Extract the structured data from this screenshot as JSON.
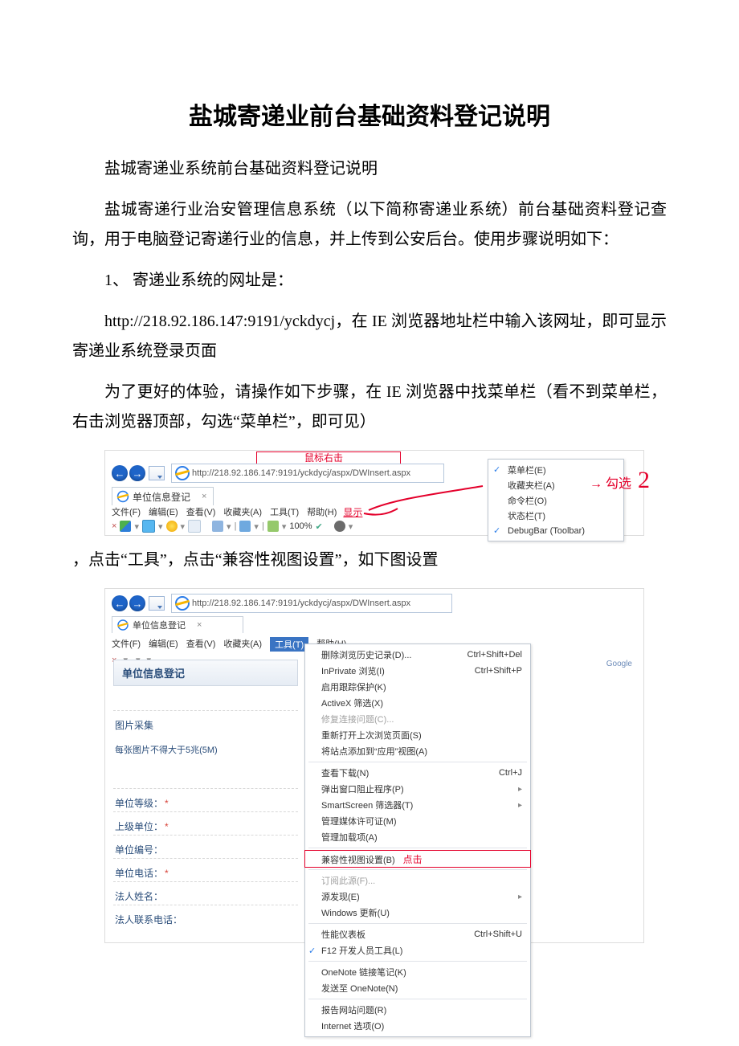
{
  "title": "盐城寄递业前台基础资料登记说明",
  "p1": "盐城寄递业系统前台基础资料登记说明",
  "p2": "盐城寄递行业治安管理信息系统（以下简称寄递业系统）前台基础资料登记查询，用于电脑登记寄递行业的信息，并上传到公安后台。使用步骤说明如下：",
  "p3": "1、 寄递业系统的网址是：",
  "p4": "http://218.92.186.147:9191/yckdycj，在 IE 浏览器地址栏中输入该网址，即可显示寄递业系统登录页面",
  "p5": "为了更好的体验，请操作如下步骤，在 IE 浏览器中找菜单栏（看不到菜单栏，右击浏览器顶部，勾选“菜单栏”，即可见）",
  "p6": "，点击“工具”，点击“兼容性视图设置”，如下图设置",
  "ss1": {
    "annot_rightclick": "鼠标右击",
    "annot_check": "勾选",
    "annot_show": "显示",
    "url": "http://218.92.186.147:9191/yckdycj/aspx/DWInsert.aspx",
    "tab_title": "单位信息登记",
    "menus": [
      "文件(F)",
      "编辑(E)",
      "查看(V)",
      "收藏夹(A)",
      "工具(T)",
      "帮助(H)"
    ],
    "zoom": "100%",
    "context_menu": [
      {
        "label": "菜单栏(E)",
        "checked": true
      },
      {
        "label": "收藏夹栏(A)",
        "checked": false
      },
      {
        "label": "命令栏(O)",
        "checked": false
      },
      {
        "label": "状态栏(T)",
        "checked": false
      },
      {
        "label": "DebugBar (Toolbar)",
        "checked": true
      }
    ]
  },
  "ss2": {
    "url": "http://218.92.186.147:9191/yckdycj/aspx/DWInsert.aspx",
    "tab_title": "单位信息登记",
    "menus_left": [
      "文件(F)",
      "编辑(E)",
      "查看(V)",
      "收藏夹(A)"
    ],
    "menu_tools": "工具(T)",
    "menu_help": "帮助(H)",
    "form_title": "单位信息登记",
    "form_sec1": "图片采集",
    "form_sec1_note": "每张图片不得大于5兆(5M)",
    "fields": [
      {
        "label": "单位等级：",
        "req": true
      },
      {
        "label": "上级单位：",
        "req": true
      },
      {
        "label": "单位编号：",
        "req": false
      },
      {
        "label": "单位电话：",
        "req": true
      },
      {
        "label": "法人姓名：",
        "req": false
      },
      {
        "label": "法人联系电话：",
        "req": false
      }
    ],
    "tools_items": [
      {
        "label": "删除浏览历史记录(D)...",
        "shortcut": "Ctrl+Shift+Del"
      },
      {
        "label": "InPrivate 浏览(I)",
        "shortcut": "Ctrl+Shift+P"
      },
      {
        "label": "启用跟踪保护(K)"
      },
      {
        "label": "ActiveX 筛选(X)"
      },
      {
        "label": "修复连接问题(C)...",
        "dim": true
      },
      {
        "label": "重新打开上次浏览页面(S)"
      },
      {
        "label": "将站点添加到“应用”视图(A)"
      },
      {
        "sep": true
      },
      {
        "label": "查看下载(N)",
        "shortcut": "Ctrl+J"
      },
      {
        "label": "弹出窗口阻止程序(P)",
        "sub": true
      },
      {
        "label": "SmartScreen 筛选器(T)",
        "sub": true
      },
      {
        "label": "管理媒体许可证(M)"
      },
      {
        "label": "管理加载项(A)"
      },
      {
        "sep": true
      },
      {
        "label": "兼容性视图设置(B)",
        "highlight": true,
        "annot": "点击"
      },
      {
        "sep": true
      },
      {
        "label": "订阅此源(F)...",
        "dim": true
      },
      {
        "label": "源发现(E)",
        "sub": true
      },
      {
        "label": "Windows 更新(U)"
      },
      {
        "sep": true
      },
      {
        "label": "性能仪表板",
        "shortcut": "Ctrl+Shift+U"
      },
      {
        "label": "F12 开发人员工具(L)",
        "checked": true
      },
      {
        "sep": true
      },
      {
        "label": "OneNote 链接笔记(K)"
      },
      {
        "label": "发送至 OneNote(N)"
      },
      {
        "sep": true
      },
      {
        "label": "报告网站问题(R)"
      },
      {
        "label": "Internet 选项(O)"
      }
    ],
    "right_label": "Google"
  }
}
